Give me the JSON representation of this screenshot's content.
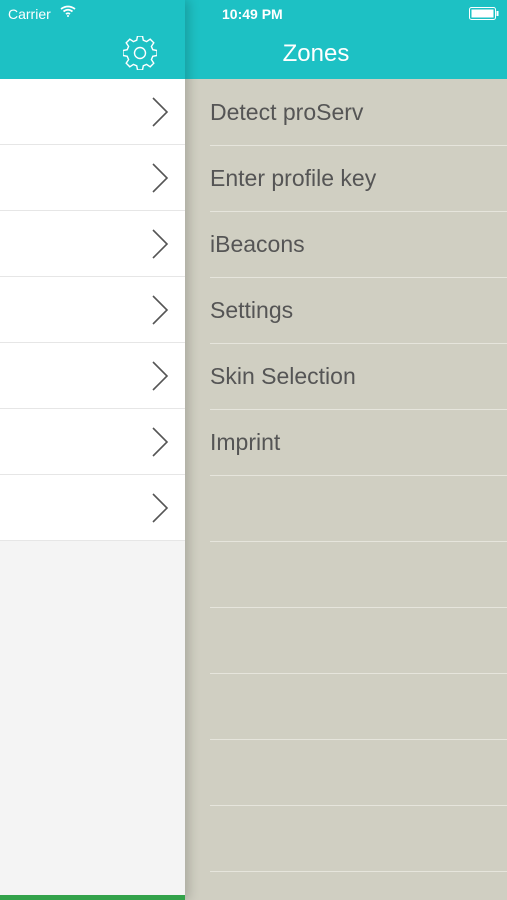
{
  "status_bar": {
    "carrier": "Carrier",
    "time": "10:49 PM"
  },
  "main_header": {
    "settings_icon": "gear-icon"
  },
  "main_rows": [
    {
      "icon": "chevron-right-icon"
    },
    {
      "icon": "chevron-right-icon"
    },
    {
      "icon": "chevron-right-icon"
    },
    {
      "icon": "chevron-right-icon"
    },
    {
      "icon": "chevron-right-icon"
    },
    {
      "icon": "chevron-right-icon"
    },
    {
      "icon": "chevron-right-icon"
    }
  ],
  "menu": {
    "title": "Zones",
    "items": [
      {
        "label": "Detect proServ"
      },
      {
        "label": "Enter profile key"
      },
      {
        "label": "iBeacons"
      },
      {
        "label": "Settings"
      },
      {
        "label": "Skin Selection"
      },
      {
        "label": "Imprint"
      }
    ]
  },
  "colors": {
    "accent": "#1dc1c4",
    "menu_background": "#d0cfc2",
    "bottom_bar": "#33a24a"
  }
}
